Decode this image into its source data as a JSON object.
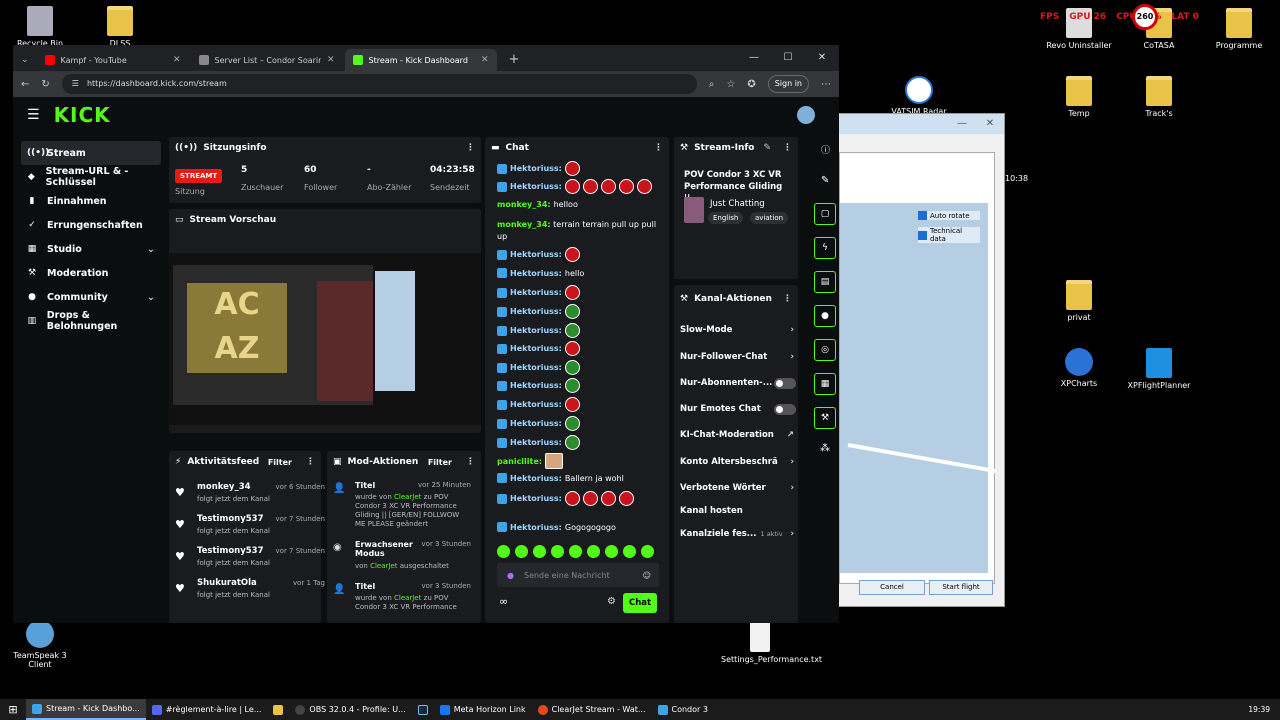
{
  "desktop": {
    "icons": [
      {
        "label": "Recycle Bin"
      },
      {
        "label": "DLSS"
      },
      {
        "label": "Revo Uninstaller"
      },
      {
        "label": "CoTASA"
      },
      {
        "label": "Programme"
      },
      {
        "label": "VATSIM Radar"
      },
      {
        "label": "Temp"
      },
      {
        "label": "Track's"
      },
      {
        "label": "privat"
      },
      {
        "label": "XPCharts"
      },
      {
        "label": "XPFlightPlanner"
      },
      {
        "label": "TeamSpeak 3 Client"
      },
      {
        "label": "Settings_Performance.txt"
      }
    ],
    "hud": {
      "fps": "FPS",
      "gpu": "GPU 26",
      "cpu": "CPU 13%",
      "lat": "LAT 0",
      "sign": "260"
    }
  },
  "condor": {
    "time": "10:38",
    "auto_rotate": "Auto rotate",
    "technical_data": "Technical data",
    "cancel": "Cancel",
    "start_flight": "Start flight"
  },
  "browser": {
    "tabs": [
      {
        "title": "Kampf - YouTube",
        "color": "#ff0000"
      },
      {
        "title": "Server List – Condor Soaring",
        "color": "#888888"
      },
      {
        "title": "Stream - Kick Dashboard",
        "color": "#53fc18"
      }
    ],
    "url": "https://dashboard.kick.com/stream",
    "sign_in": "Sign in"
  },
  "kick": {
    "logo": "KICK",
    "nav": [
      {
        "label": "Stream",
        "icon": "((•))"
      },
      {
        "label": "Stream-URL & -Schlüssel",
        "icon": "◆"
      },
      {
        "label": "Einnahmen",
        "icon": "▮"
      },
      {
        "label": "Errungenschaften",
        "icon": "✓"
      },
      {
        "label": "Studio",
        "icon": "▦"
      },
      {
        "label": "Moderation",
        "icon": "⚒"
      },
      {
        "label": "Community",
        "icon": "●"
      },
      {
        "label": "Drops & Belohnungen",
        "icon": "▥"
      }
    ],
    "session": {
      "title": "Sitzungsinfo",
      "badge": "STREAMT",
      "badge_label": "Sitzung",
      "viewers": "5",
      "viewers_label": "Zuschauer",
      "followers": "60",
      "followers_label": "Follower",
      "subs": "-",
      "subs_label": "Abo-Zähler",
      "time": "04:23:58",
      "time_label": "Sendezeit"
    },
    "preview_title": "Stream Vorschau",
    "preview_text": "AC AZ",
    "activity": {
      "title": "Aktivitätsfeed",
      "filter": "Filter",
      "items": [
        {
          "name": "monkey_34",
          "time": "vor 6 Stunden",
          "desc": "folgt jetzt dem Kanal"
        },
        {
          "name": "Testimony537",
          "time": "vor 7 Stunden",
          "desc": "folgt jetzt dem Kanal"
        },
        {
          "name": "Testimony537",
          "time": "vor 7 Stunden",
          "desc": "folgt jetzt dem Kanal"
        },
        {
          "name": "ShukuratOla",
          "time": "vor 1 Tag",
          "desc": "folgt jetzt dem Kanal"
        }
      ]
    },
    "mod": {
      "title": "Mod-Aktionen",
      "filter": "Filter",
      "items": [
        {
          "title": "Titel",
          "time": "vor 25 Minuten",
          "pre": "wurde von ",
          "user": "ClearJet",
          "post": " zu POV Condor 3 XC VR Performance Gliding || [GER/EN] FOLLWOW ME PLEASE geändert"
        },
        {
          "title": "Erwachsener Modus",
          "time": "vor 3 Stunden",
          "pre": "von ",
          "user": "ClearJet",
          "post": " ausgeschaltet"
        },
        {
          "title": "Titel",
          "time": "vor 3 Stunden",
          "pre": "wurde von ",
          "user": "ClearJet",
          "post": " zu POV Condor 3 XC VR Performance"
        }
      ]
    },
    "chat": {
      "title": "Chat",
      "messages": [
        {
          "user": "Hektoriuss:",
          "text": ""
        },
        {
          "user": "Hektoriuss:",
          "text": ""
        },
        {
          "user": "monkey_34:",
          "text": "helloo"
        },
        {
          "user": "monkey_34:",
          "text": "terrain terrain pull up pull up"
        },
        {
          "user": "Hektoriuss:",
          "text": ""
        },
        {
          "user": "Hektoriuss:",
          "text": "hello"
        },
        {
          "user": "Hektoriuss:",
          "text": ""
        },
        {
          "user": "Hektoriuss:",
          "text": ""
        },
        {
          "user": "Hektoriuss:",
          "text": ""
        },
        {
          "user": "Hektoriuss:",
          "text": ""
        },
        {
          "user": "Hektoriuss:",
          "text": ""
        },
        {
          "user": "Hektoriuss:",
          "text": ""
        },
        {
          "user": "Hektoriuss:",
          "text": ""
        },
        {
          "user": "Hektoriuss:",
          "text": ""
        },
        {
          "user": "Hektoriuss:",
          "text": ""
        },
        {
          "user": "panicllite:",
          "text": ""
        },
        {
          "user": "Hektoriuss:",
          "text": "Ballern ja wohl"
        },
        {
          "user": "Hektoriuss:",
          "text": ""
        },
        {
          "user": "Hektoriuss:",
          "text": "Gogogogogo"
        }
      ],
      "placeholder": "Sende eine Nachricht",
      "send": "Chat",
      "infinity": "∞"
    },
    "stream_info": {
      "title": "Stream-Info",
      "stream_title": "POV Condor 3 XC VR Performance Gliding ||...",
      "category": "Just Chatting",
      "tags": [
        "English",
        "aviation"
      ]
    },
    "channel_actions": {
      "title": "Kanal-Aktionen",
      "items": [
        {
          "label": "Slow-Mode"
        },
        {
          "label": "Nur-Follower-Chat"
        },
        {
          "label": "Nur-Abonnenten-..."
        },
        {
          "label": "Nur Emotes Chat"
        },
        {
          "label": "KI-Chat-Moderation"
        },
        {
          "label": "Konto Altersbeschränk..."
        },
        {
          "label": "Verbotene Wörter"
        },
        {
          "label": "Kanal hosten"
        },
        {
          "label": "Kanalziele fes...",
          "extra": "1 aktiv"
        }
      ]
    }
  },
  "taskbar": {
    "items": [
      {
        "label": "Stream - Kick Dashbo...",
        "color": "#3fa3e8"
      },
      {
        "label": "#règlement-à-lire | Le...",
        "color": "#5865f2"
      },
      {
        "label": "",
        "color": "#e9c24a"
      },
      {
        "label": "OBS 32.0.4 - Profile: U...",
        "color": "#444444"
      },
      {
        "label": "",
        "color": "#1b2838"
      },
      {
        "label": "Meta Horizon Link",
        "color": "#1877f2"
      },
      {
        "label": "ClearJet Stream - Wat...",
        "color": "#e64a19"
      },
      {
        "label": "Condor 3",
        "color": "#3fa3e8"
      }
    ],
    "clock": "19:39"
  }
}
